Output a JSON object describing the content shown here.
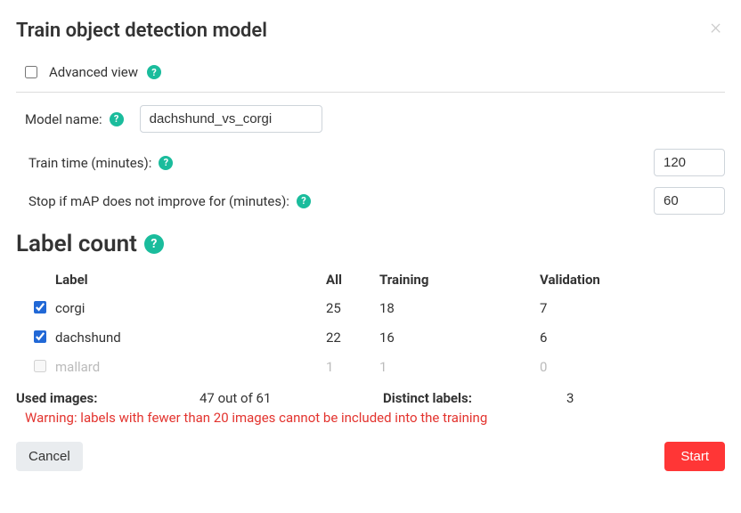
{
  "modal": {
    "title": "Train object detection model",
    "close_glyph": "×"
  },
  "advanced": {
    "label": "Advanced view",
    "checked": false
  },
  "fields": {
    "model_name": {
      "label": "Model name:",
      "value": "dachshund_vs_corgi"
    },
    "train_time": {
      "label": "Train time (minutes):",
      "value": "120"
    },
    "stop_if": {
      "label": "Stop if mAP does not improve for (minutes):",
      "value": "60"
    }
  },
  "help_glyph": "?",
  "section": {
    "title": "Label count"
  },
  "table": {
    "headers": {
      "label": "Label",
      "all": "All",
      "training": "Training",
      "validation": "Validation"
    },
    "rows": [
      {
        "name": "corgi",
        "checked": true,
        "disabled": false,
        "all": "25",
        "training": "18",
        "validation": "7"
      },
      {
        "name": "dachshund",
        "checked": true,
        "disabled": false,
        "all": "22",
        "training": "16",
        "validation": "6"
      },
      {
        "name": "mallard",
        "checked": false,
        "disabled": true,
        "all": "1",
        "training": "1",
        "validation": "0"
      }
    ]
  },
  "summary": {
    "used_images_label": "Used images:",
    "used_images_value": "47 out of 61",
    "distinct_labels_label": "Distinct labels:",
    "distinct_labels_value": "3"
  },
  "warning": "Warning: labels with fewer than 20 images cannot be included into the training",
  "buttons": {
    "cancel": "Cancel",
    "start": "Start"
  }
}
